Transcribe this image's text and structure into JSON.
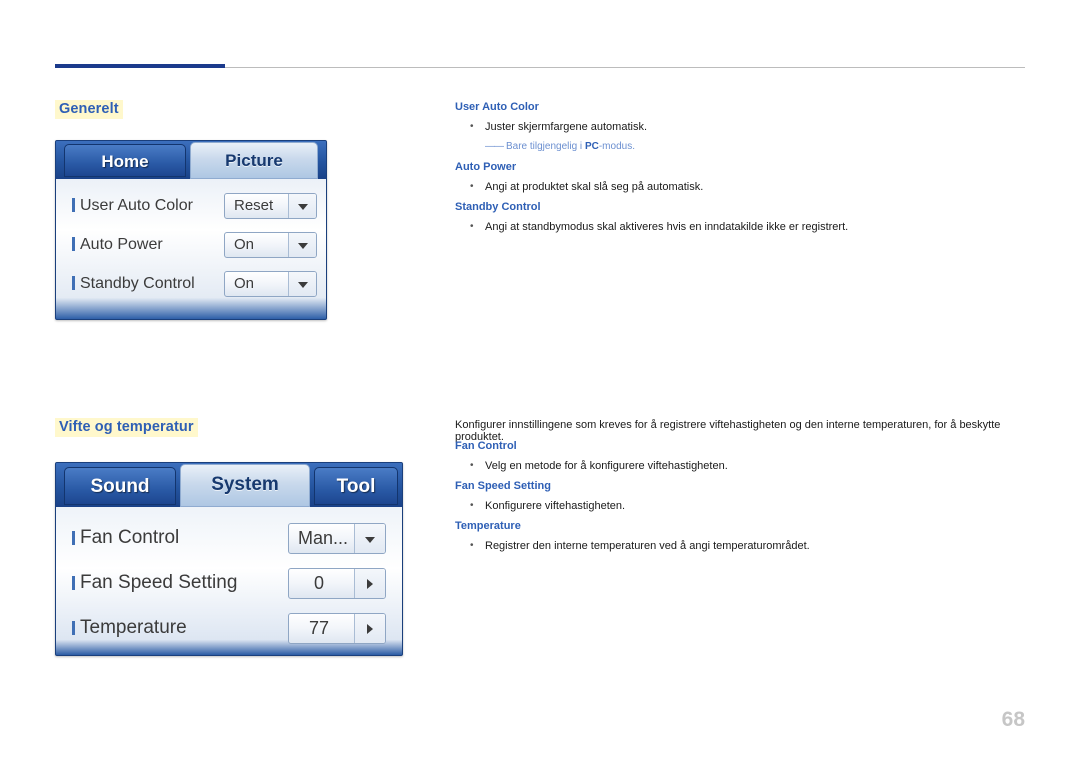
{
  "page": {
    "number": "68"
  },
  "sections": [
    {
      "id": "generelt",
      "title": "Generelt",
      "osd": {
        "tabs": [
          {
            "label": "Home",
            "state": "inactive"
          },
          {
            "label": "Picture",
            "state": "active"
          }
        ],
        "rows": [
          {
            "label": "User Auto Color",
            "value": "Reset",
            "control": "dropdown"
          },
          {
            "label": "Auto Power",
            "value": "On",
            "control": "dropdown"
          },
          {
            "label": "Standby Control",
            "value": "On",
            "control": "dropdown"
          }
        ]
      },
      "entries": [
        {
          "heading": "User Auto Color",
          "bullet": "Juster skjermfargene automatisk.",
          "note_prefix": "Bare tilgjengelig i ",
          "note_bold": "PC",
          "note_suffix": "-modus."
        },
        {
          "heading": "Auto Power",
          "bullet": "Angi at produktet skal slå seg på automatisk."
        },
        {
          "heading": "Standby Control",
          "bullet": "Angi at standbymodus skal aktiveres hvis en inndatakilde ikke er registrert."
        }
      ]
    },
    {
      "id": "vifte",
      "title": "Vifte og temperatur",
      "intro": "Konfigurer innstillingene som kreves for å registrere viftehastigheten og den interne temperaturen, for å beskytte produktet.",
      "osd": {
        "tabs": [
          {
            "label": "Sound",
            "state": "inactive"
          },
          {
            "label": "System",
            "state": "active"
          },
          {
            "label": "Tool",
            "state": "inactive"
          }
        ],
        "rows": [
          {
            "label": "Fan Control",
            "value": "Man...",
            "control": "dropdown"
          },
          {
            "label": "Fan Speed Setting",
            "value": "0",
            "control": "stepper"
          },
          {
            "label": "Temperature",
            "value": "77",
            "control": "stepper"
          }
        ]
      },
      "entries": [
        {
          "heading": "Fan Control",
          "bullet": "Velg en metode for å konfigurere viftehastigheten."
        },
        {
          "heading": "Fan Speed Setting",
          "bullet": "Konfigurere viftehastigheten."
        },
        {
          "heading": "Temperature",
          "bullet": "Registrer den interne temperaturen ved å angi temperaturområdet."
        }
      ]
    }
  ],
  "icons": {
    "chevron_down": "chevron-down-icon",
    "chevron_right": "chevron-right-icon"
  }
}
